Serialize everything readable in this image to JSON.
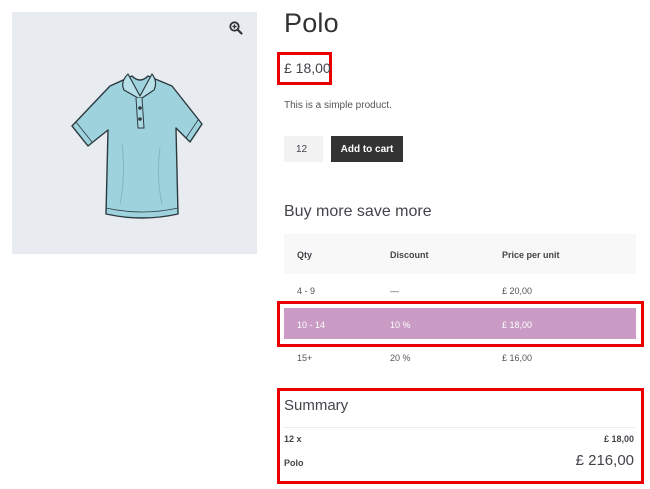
{
  "product": {
    "title": "Polo",
    "price": "£ 18,00",
    "description": "This is a simple product.",
    "image_alt": "Polo shirt"
  },
  "cart": {
    "quantity": "12",
    "add_to_cart_label": "Add to cart"
  },
  "discounts": {
    "title": "Buy more save more",
    "headers": [
      "Qty",
      "Discount",
      "Price per unit"
    ],
    "rows": [
      {
        "qty": "4 - 9",
        "discount": "—",
        "price": "£ 20,00",
        "highlighted": false
      },
      {
        "qty": "10 - 14",
        "discount": "10 %",
        "price": "£ 18,00",
        "highlighted": true
      },
      {
        "qty": "15+",
        "discount": "20 %",
        "price": "£ 16,00",
        "highlighted": false
      }
    ]
  },
  "summary": {
    "title": "Summary",
    "qty_label": "12 x",
    "unit_price": "£ 18,00",
    "product_name": "Polo",
    "total": "£ 216,00"
  },
  "colors": {
    "highlight_row": "#c99bc5",
    "annotation_border": "#e60000",
    "button": "#333333",
    "image_bg": "#e8ebef"
  },
  "icons": {
    "zoom": "zoom-in-icon"
  }
}
